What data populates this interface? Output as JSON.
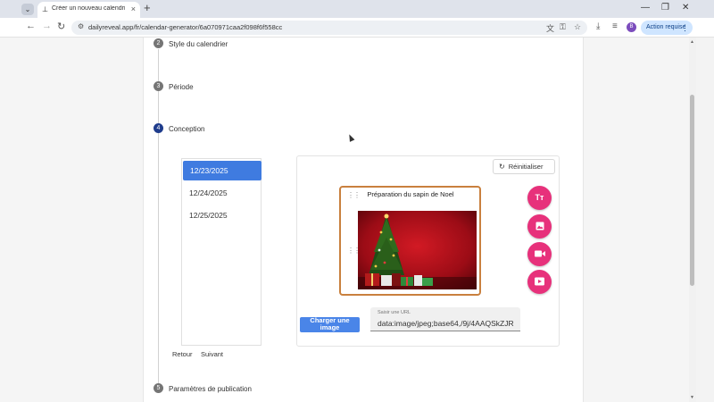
{
  "browser": {
    "tab_title": "Créer un nouveau calendrier d",
    "tab_favicon": "⊥",
    "tab_close": "×",
    "new_tab": "+",
    "url": "dailyreveal.app/fr/calendar-generator/6a070971caa2f098f6f558cc",
    "profile_initial": "B",
    "action_button": "Action requise",
    "icons": [
      "chevron-down-icon",
      "back-icon",
      "forward-icon",
      "reload-icon",
      "site-info-icon",
      "translate-icon",
      "password-key-icon",
      "star-icon",
      "download-icon",
      "tab-search-icon",
      "avatar",
      "kebab-menu-icon",
      "minimize-icon",
      "maximize-icon",
      "close-window-icon"
    ]
  },
  "stepper": {
    "steps": [
      {
        "number": "2",
        "label": "Style du calendrier"
      },
      {
        "number": "3",
        "label": "Période"
      },
      {
        "number": "4",
        "label": "Conception"
      },
      {
        "number": "5",
        "label": "Paramètres de publication"
      }
    ]
  },
  "dates": [
    "12/23/2025",
    "12/24/2025",
    "12/25/2025"
  ],
  "navigation": {
    "back": "Retour",
    "next": "Suivant"
  },
  "editor": {
    "reset_label": "Réinitialiser",
    "card_title": "Préparation du sapin de Noel",
    "fab_icons": [
      "text-icon",
      "image-icon",
      "video-icon",
      "youtube-icon"
    ],
    "fab_text_glyph": "Tт",
    "upload_label": "Charger une image",
    "url_field_label": "Saisir une URL",
    "url_field_value": "data:image/jpeg;base64,/9j/4AAQSkZJR"
  },
  "colors": {
    "accent_blue": "#3f7be0",
    "fab_pink": "#e7317b",
    "card_border": "#c9803e",
    "active_step": "#1f3c8c",
    "action_button_bg": "#cfe5ff"
  }
}
